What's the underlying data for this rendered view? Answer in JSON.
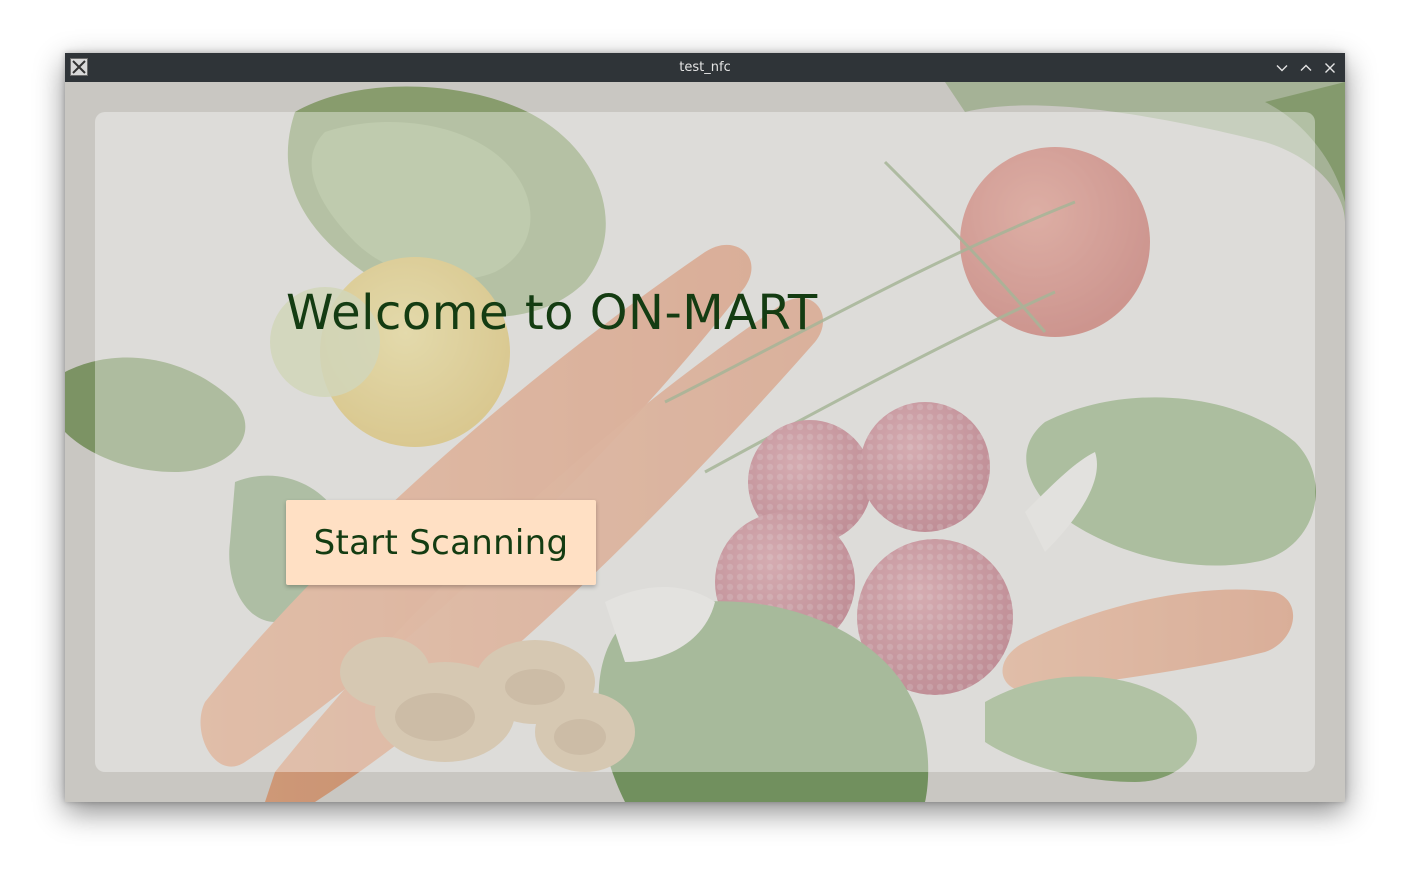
{
  "window": {
    "title": "test_nfc",
    "app_icon": "x-app-icon",
    "controls": [
      "minimize-icon",
      "maximize-icon",
      "close-icon"
    ]
  },
  "main": {
    "welcome_text": "Welcome to ON-MART",
    "start_button_label": "Start Scanning"
  },
  "colors": {
    "titlebar": "#2f3438",
    "text_green": "#143c12",
    "button_bg": "#ffe0c4"
  }
}
